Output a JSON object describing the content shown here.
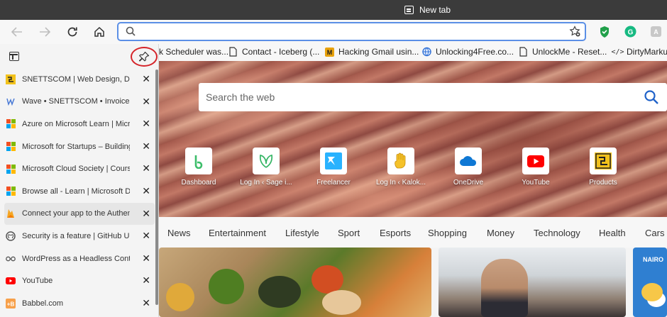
{
  "window": {
    "tab_title": "New tab"
  },
  "address_bar": {
    "value": "",
    "placeholder": ""
  },
  "bookmarks": [
    {
      "label": "k Scheduler was...",
      "icon": "page-icon"
    },
    {
      "label": "Contact - Iceberg (...",
      "icon": "page-icon"
    },
    {
      "label": "Hacking Gmail usin...",
      "icon": "m-logo-icon"
    },
    {
      "label": "Unlocking4Free.co...",
      "icon": "globe-icon"
    },
    {
      "label": "UnlockMe - Reset...",
      "icon": "page-icon"
    },
    {
      "label": "DirtyMarkup",
      "icon": "code-icon"
    }
  ],
  "sidebar": {
    "tabs": [
      {
        "label": "SNETTSCOM | Web Design, Deve",
        "icon": "snettscom-icon",
        "color": "#f2c21b"
      },
      {
        "label": "Wave • SNETTSCOM • Invoices",
        "icon": "wave-icon",
        "color": "#4b7bd6"
      },
      {
        "label": "Azure on Microsoft Learn | Micro",
        "icon": "microsoft-icon",
        "color": "#f25022"
      },
      {
        "label": "Microsoft for Startups – Building",
        "icon": "microsoft-icon",
        "color": "#f25022"
      },
      {
        "label": "Microsoft Cloud Society | Course",
        "icon": "microsoft-icon",
        "color": "#f25022"
      },
      {
        "label": "Browse all - Learn | Microsoft Do",
        "icon": "microsoft-icon",
        "color": "#f25022"
      },
      {
        "label": "Connect your app to the Authent",
        "icon": "firebase-icon",
        "color": "#f5a623"
      },
      {
        "label": "Security is a feature | GitHub Uni",
        "icon": "github-icon",
        "color": "#555555"
      },
      {
        "label": "WordPress as a Headless Conten",
        "icon": "glasses-icon",
        "color": "#555555"
      },
      {
        "label": "YouTube",
        "icon": "youtube-icon",
        "color": "#ff0000"
      },
      {
        "label": "Babbel.com",
        "icon": "babbel-icon",
        "color": "#f7a04a"
      }
    ],
    "active_index": 6
  },
  "newtab": {
    "search_placeholder": "Search the web",
    "quicklinks": [
      {
        "label": "Dashboard",
        "icon": "b-logo-icon"
      },
      {
        "label": "Log In ‹ Sage i...",
        "icon": "sage-icon"
      },
      {
        "label": "Freelancer",
        "icon": "freelancer-icon"
      },
      {
        "label": "Log In ‹ Kalok...",
        "icon": "hand-icon"
      },
      {
        "label": "OneDrive",
        "icon": "onedrive-icon"
      },
      {
        "label": "YouTube",
        "icon": "youtube-icon"
      },
      {
        "label": "Products",
        "icon": "snettscom-icon"
      }
    ],
    "categories": [
      "News",
      "Entertainment",
      "Lifestyle",
      "Sport",
      "Esports",
      "Shopping",
      "Money",
      "Technology",
      "Health",
      "Cars"
    ],
    "weather_label": "NAIRO"
  }
}
